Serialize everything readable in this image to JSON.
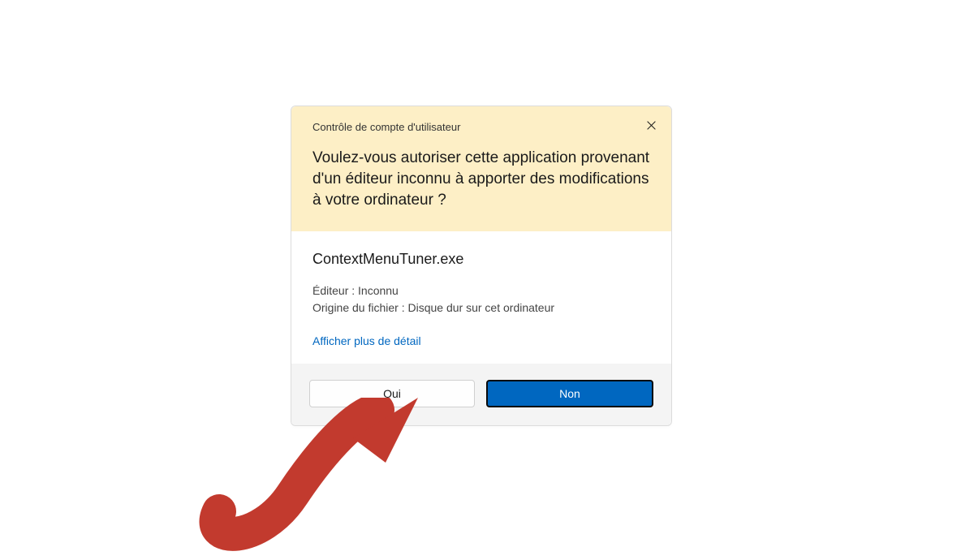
{
  "header": {
    "title": "Contrôle de compte d'utilisateur",
    "question": "Voulez-vous autoriser cette application provenant d'un éditeur inconnu à apporter des modifications à votre ordinateur ?"
  },
  "body": {
    "app_name": "ContextMenuTuner.exe",
    "publisher_line": "Éditeur : Inconnu",
    "origin_line": "Origine du fichier : Disque dur sur cet ordinateur",
    "more_details": "Afficher plus de détail"
  },
  "buttons": {
    "yes": "Oui",
    "no": "Non"
  }
}
